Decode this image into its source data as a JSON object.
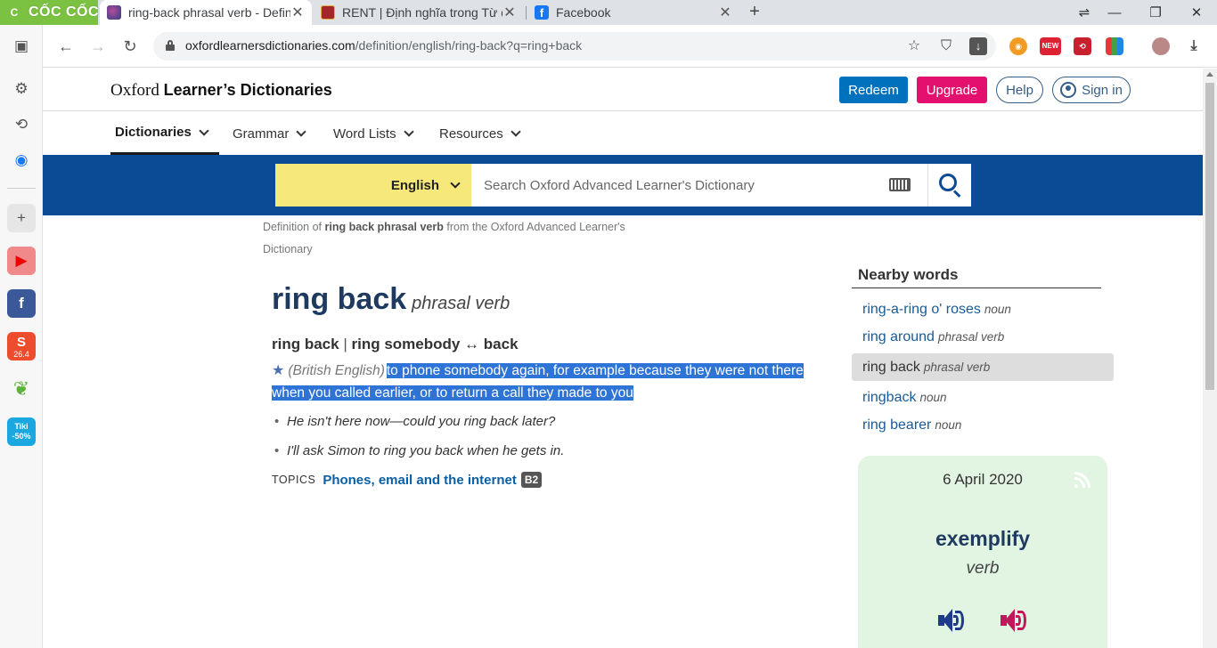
{
  "browser": {
    "brand": "CỐC CỐC",
    "tabs": [
      {
        "title": "ring-back phrasal verb - Defin",
        "close": "✕"
      },
      {
        "title": "RENT | Định nghĩa trong Từ điể",
        "close": "✕"
      },
      {
        "title": "Facebook",
        "close": "✕"
      }
    ],
    "new_tab": "+",
    "url_host": "oxfordlearnersdictionaries.com",
    "url_path": "/definition/english/ring-back?q=ring+back",
    "new_badge": "NEW"
  },
  "sidebar": {
    "shopee_badge": "26.4",
    "tiki_label": "Tiki",
    "tiki_discount": "-50%"
  },
  "site": {
    "logo_prefix": "Oxford",
    "logo_main": "Learner’s Dictionaries",
    "redeem": "Redeem",
    "upgrade": "Upgrade",
    "help": "Help",
    "sign_in": "Sign in"
  },
  "nav": {
    "dictionaries": "Dictionaries",
    "grammar": "Grammar",
    "word_lists": "Word Lists",
    "resources": "Resources"
  },
  "search": {
    "language": "English",
    "placeholder": "Search Oxford Advanced Learner's Dictionary"
  },
  "entry": {
    "source_prefix": "Definition of",
    "source_term": "ring back phrasal verb",
    "source_suffix": "from the Oxford Advanced Learner's Dictionary",
    "headword": "ring back",
    "pos": "phrasal verb",
    "form1": "ring back",
    "form_sep": "|",
    "form2": "ring somebody ↔ back",
    "region_label": "(British English)",
    "definition": "to phone somebody again, for example because they were not there when you called earlier, or to return a call they made to you",
    "examples": [
      "He isn't here now—could you ring back later?",
      "I'll ask Simon to ring you back when he gets in."
    ],
    "topics_label": "TOPICS",
    "topic": "Phones, email and the internet",
    "topic_level": "B2"
  },
  "nearby": {
    "title": "Nearby words",
    "items": [
      {
        "word": "ring-a-ring o' roses",
        "pos": "noun"
      },
      {
        "word": "ring around",
        "pos": "phrasal verb"
      },
      {
        "word": "ring back",
        "pos": "phrasal verb"
      },
      {
        "word": "ringback",
        "pos": "noun"
      },
      {
        "word": "ring bearer",
        "pos": "noun"
      }
    ]
  },
  "word_of_the_day": {
    "date": "6 April 2020",
    "word": "exemplify",
    "pos": "verb",
    "audio_uk_color": "#1e3a8a",
    "audio_us_color": "#c2185b"
  }
}
